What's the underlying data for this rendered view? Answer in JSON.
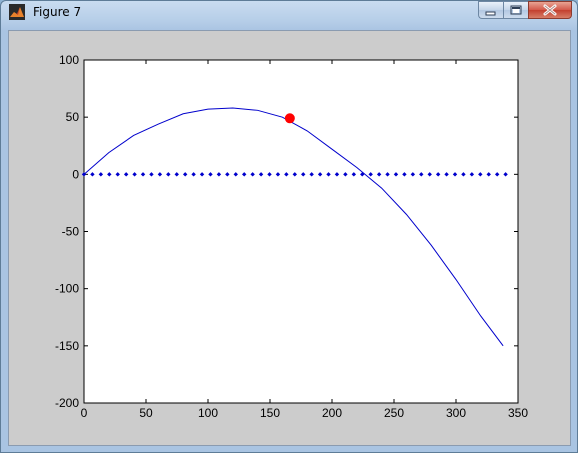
{
  "window": {
    "title": "Figure 7"
  },
  "icons": {
    "app": "matlab-figure-icon",
    "minimize": "minimize-icon",
    "maximize": "maximize-icon",
    "close": "close-icon"
  },
  "colors": {
    "curve": "#0000cc",
    "markers": "#0000cc",
    "point": "#ff0000",
    "axes_bg": "#ffffff",
    "figure_bg": "#cccccc"
  },
  "chart_data": {
    "type": "line",
    "xlim": [
      0,
      350
    ],
    "ylim": [
      -200,
      100
    ],
    "xticks": [
      0,
      50,
      100,
      150,
      200,
      250,
      300,
      350
    ],
    "yticks": [
      100,
      50,
      0,
      -50,
      -100,
      -150,
      -200
    ],
    "grid": false,
    "series": [
      {
        "kind": "curve",
        "color": "#0000cc",
        "x": [
          0,
          20,
          40,
          60,
          80,
          100,
          120,
          140,
          160,
          180,
          200,
          220,
          240,
          260,
          280,
          300,
          320,
          338
        ],
        "y": [
          0,
          19,
          34,
          44,
          53,
          57,
          58,
          56,
          50,
          38,
          22,
          6,
          -12,
          -35,
          -62,
          -92,
          -124,
          -150
        ]
      },
      {
        "kind": "markers",
        "color": "#0000cc",
        "x_start": 0,
        "x_end": 340,
        "x_step": 6.8,
        "y": 0
      },
      {
        "kind": "point",
        "color": "#ff0000",
        "x": 166,
        "y": 49
      }
    ]
  }
}
